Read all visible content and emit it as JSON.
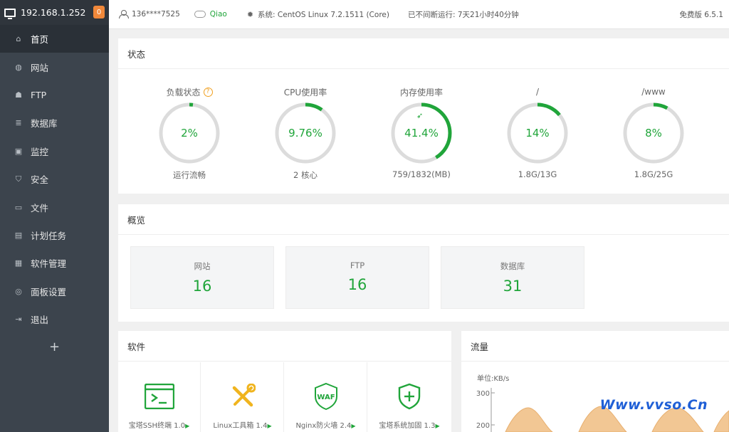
{
  "sidebar": {
    "server_ip": "192.168.1.252",
    "badge": "0",
    "items": [
      {
        "label": "首页",
        "icon": "home-icon",
        "active": true
      },
      {
        "label": "网站",
        "icon": "globe-icon"
      },
      {
        "label": "FTP",
        "icon": "ftp-icon"
      },
      {
        "label": "数据库",
        "icon": "database-icon"
      },
      {
        "label": "监控",
        "icon": "monitor-icon"
      },
      {
        "label": "安全",
        "icon": "shield-icon"
      },
      {
        "label": "文件",
        "icon": "folder-icon"
      },
      {
        "label": "计划任务",
        "icon": "calendar-icon"
      },
      {
        "label": "软件管理",
        "icon": "grid-icon"
      },
      {
        "label": "面板设置",
        "icon": "settings-icon"
      },
      {
        "label": "退出",
        "icon": "logout-icon"
      }
    ],
    "add_label": "+"
  },
  "topbar": {
    "user": "136****7525",
    "cloud_user": "Qiao",
    "system": "系统:  CentOS Linux 7.2.1511 (Core)",
    "uptime": "已不间断运行: 7天21小时40分钟",
    "version": "免费版 6.5.1"
  },
  "status": {
    "title": "状态",
    "gauges": [
      {
        "title": "负载状态",
        "value_text": "2%",
        "value": 2,
        "sub": "运行流畅",
        "help": "?"
      },
      {
        "title": "CPU使用率",
        "value_text": "9.76%",
        "value": 9.76,
        "sub": "2 核心"
      },
      {
        "title": "内存使用率",
        "value_text": "41.4%",
        "value": 41.4,
        "sub": "759/1832(MB)",
        "icon": "rocket-icon"
      },
      {
        "title": "/",
        "value_text": "14%",
        "value": 14,
        "sub": "1.8G/13G"
      },
      {
        "title": "/www",
        "value_text": "8%",
        "value": 8,
        "sub": "1.8G/25G"
      }
    ]
  },
  "overview": {
    "title": "概览",
    "cards": [
      {
        "label": "网站",
        "value": "16"
      },
      {
        "label": "FTP",
        "value": "16"
      },
      {
        "label": "数据库",
        "value": "31"
      }
    ]
  },
  "software": {
    "title": "软件",
    "items": [
      {
        "name": "宝塔SSH终端 1.0",
        "icon": "terminal-icon"
      },
      {
        "name": "Linux工具箱 1.4",
        "icon": "tools-icon"
      },
      {
        "name": "Nginx防火墙 2.4",
        "icon": "waf-icon",
        "icon_text": "WAF"
      },
      {
        "name": "宝塔系统加固 1.3",
        "icon": "shield-plus-icon"
      }
    ],
    "arrow": "▶"
  },
  "traffic": {
    "title": "流量",
    "unit": "单位:KB/s",
    "ticks": [
      "300",
      "200"
    ]
  },
  "watermark": "Www.vvso.Cn",
  "colors": {
    "accent": "#20a53a",
    "sidebar": "#3c444d",
    "badge": "#f0883a",
    "watermark": "#1f5fd6"
  }
}
